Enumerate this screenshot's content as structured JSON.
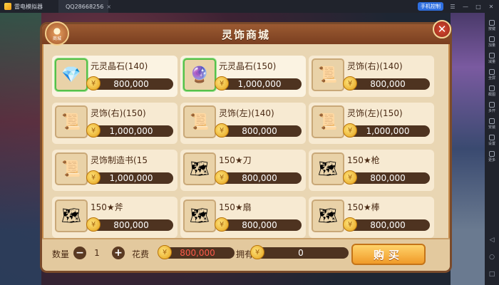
{
  "titlebar": {
    "app_name": "雷电模拟器",
    "tab_label": "QQ28668256",
    "tab_close": "×",
    "phone_button": "手机控制",
    "controls": [
      "☰",
      "—",
      "□",
      "✕"
    ]
  },
  "sidebar": {
    "items": [
      {
        "label": "按键",
        "icon": "keyboard-icon"
      },
      {
        "label": "加量",
        "icon": "volume-up-icon"
      },
      {
        "label": "减量",
        "icon": "volume-down-icon"
      },
      {
        "label": "全屏",
        "icon": "fullscreen-icon"
      },
      {
        "label": "截图",
        "icon": "screenshot-icon"
      },
      {
        "label": "多开",
        "icon": "multi-instance-icon"
      },
      {
        "label": "安装",
        "icon": "install-icon"
      },
      {
        "label": "设置",
        "icon": "settings-icon"
      },
      {
        "label": "更多",
        "icon": "more-icon"
      }
    ],
    "nav": [
      "◁",
      "○",
      "□"
    ]
  },
  "shop": {
    "title": "灵饰商城",
    "bag_label": "商城",
    "close_label": "✕",
    "items": [
      {
        "name": "元灵晶石(140)",
        "price": "800,000",
        "icon": "crystal-icon",
        "glyph": "💎",
        "selected": true
      },
      {
        "name": "元灵晶石(150)",
        "price": "1,000,000",
        "icon": "crystal-orb-icon",
        "glyph": "🔮",
        "selected": true
      },
      {
        "name": "灵饰(右)(140)",
        "price": "800,000",
        "icon": "scroll-icon",
        "glyph": "📜",
        "selected": false
      },
      {
        "name": "灵饰(右)(150)",
        "price": "1,000,000",
        "icon": "scroll-icon",
        "glyph": "📜",
        "selected": false
      },
      {
        "name": "灵饰(左)(140)",
        "price": "800,000",
        "icon": "scroll-icon",
        "glyph": "📜",
        "selected": false
      },
      {
        "name": "灵饰(左)(150)",
        "price": "1,000,000",
        "icon": "scroll-icon",
        "glyph": "📜",
        "selected": false
      },
      {
        "name": "灵饰制造书(15",
        "price": "1,000,000",
        "icon": "book-scroll-icon",
        "glyph": "📜",
        "selected": false
      },
      {
        "name": "150★刀",
        "price": "800,000",
        "icon": "blueprint-icon",
        "glyph": "🗺",
        "selected": false
      },
      {
        "name": "150★枪",
        "price": "800,000",
        "icon": "blueprint-icon",
        "glyph": "🗺",
        "selected": false
      },
      {
        "name": "150★斧",
        "price": "800,000",
        "icon": "blueprint-icon",
        "glyph": "🗺",
        "selected": false
      },
      {
        "name": "150★扇",
        "price": "800,000",
        "icon": "blueprint-icon",
        "glyph": "🗺",
        "selected": false
      },
      {
        "name": "150★棒",
        "price": "800,000",
        "icon": "blueprint-icon",
        "glyph": "🗺",
        "selected": false
      }
    ],
    "footer": {
      "quantity_label": "数量",
      "quantity": "1",
      "minus": "−",
      "plus": "+",
      "cost_label": "花费",
      "cost": "800,000",
      "own_label": "拥有",
      "own": "0",
      "buy_label": "购买"
    }
  }
}
